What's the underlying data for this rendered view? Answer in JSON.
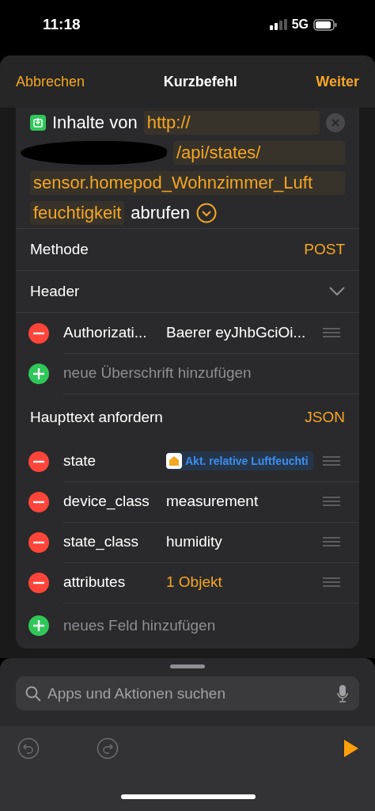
{
  "status_bar": {
    "time": "11:18",
    "network": "5G"
  },
  "nav": {
    "cancel": "Abbrechen",
    "title": "Kurzbefehl",
    "next": "Weiter"
  },
  "action": {
    "prefix": "Inhalte von",
    "url_lines": [
      "http://",
      "/api/states/",
      "sensor.homepod_Wohnzimmer_Luft",
      "feuchtigkeit"
    ],
    "redacted": true,
    "verb": "abrufen",
    "expanded": true
  },
  "method": {
    "label": "Methode",
    "value": "POST"
  },
  "header_section": {
    "label": "Header",
    "expanded": true
  },
  "headers": [
    {
      "key": "Authorizati...",
      "value": "Baerer eyJhbGciOi...",
      "kind": "text"
    }
  ],
  "add_header": {
    "label": "neue Überschrift hinzufügen"
  },
  "body_section": {
    "label": "Haupttext anfordern",
    "value": "JSON"
  },
  "fields": [
    {
      "key": "state",
      "value": "Akt. relative Luftfeuchti",
      "kind": "variable"
    },
    {
      "key": "device_class",
      "value": "measurement",
      "kind": "text"
    },
    {
      "key": "state_class",
      "value": "humidity",
      "kind": "text"
    },
    {
      "key": "attributes",
      "value": "1 Objekt",
      "kind": "accent"
    }
  ],
  "add_field": {
    "label": "neues Feld hinzufügen"
  },
  "search": {
    "placeholder": "Apps und Aktionen suchen"
  },
  "toolbar": {
    "undo_disabled": true,
    "redo_disabled": true
  }
}
